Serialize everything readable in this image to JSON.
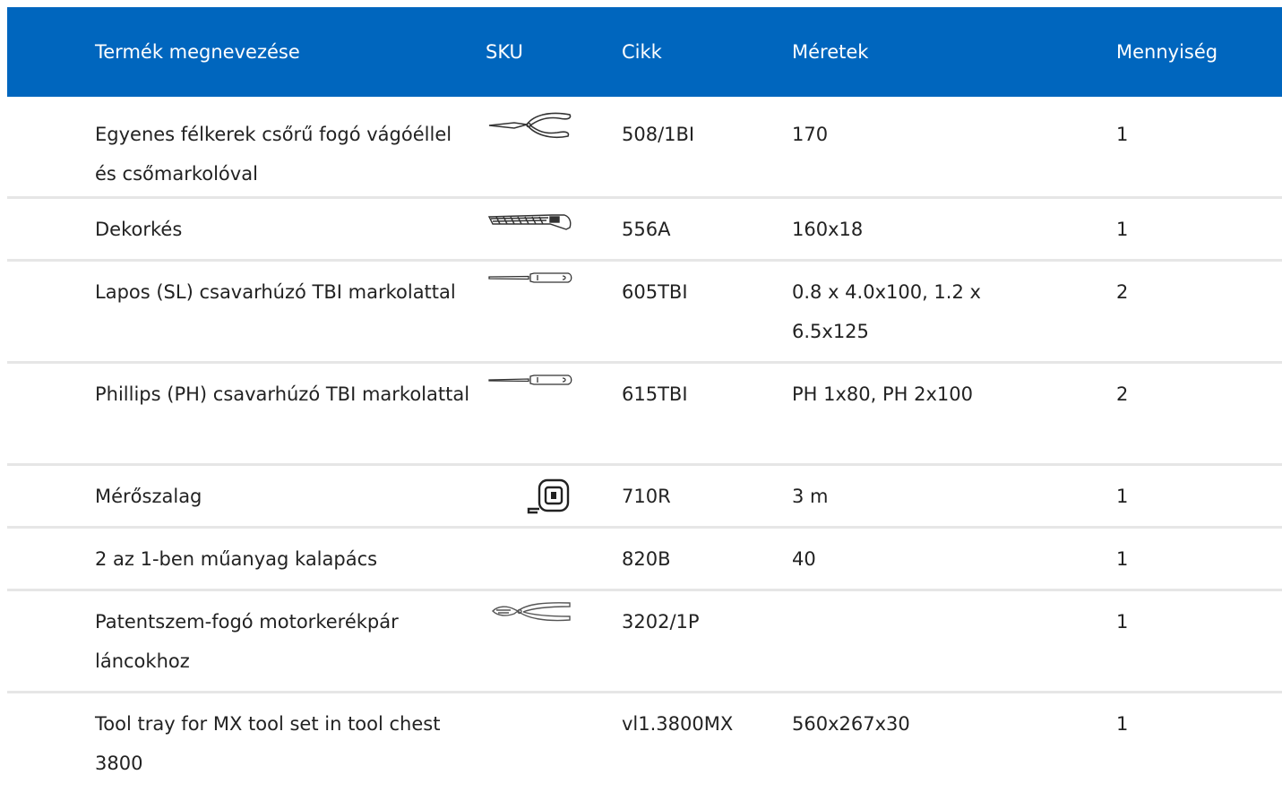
{
  "header": {
    "name": "Termék megnevezése",
    "sku": "SKU",
    "article": "Cikk",
    "size": "Méretek",
    "quantity": "Mennyiség"
  },
  "rows": [
    {
      "name": "Egyenes félkerek csőrű fogó vágóéllel és csőmarkolóval",
      "icon": "pliers-icon",
      "article": "508/1BI",
      "size": "170",
      "quantity": "1"
    },
    {
      "name": "Dekorkés",
      "icon": "utility-knife-icon",
      "article": "556A",
      "size": "160x18",
      "quantity": "1"
    },
    {
      "name": "Lapos (SL) csavarhúzó TBI markolattal",
      "icon": "screwdriver-icon",
      "article": "605TBI",
      "size": "0.8 x 4.0x100, 1.2 x 6.5x125",
      "quantity": "2"
    },
    {
      "name": "Phillips (PH) csavarhúzó TBI markolattal",
      "icon": "screwdriver-icon",
      "article": "615TBI",
      "size": "PH 1x80, PH 2x100",
      "quantity": "2"
    },
    {
      "name": "Mérőszalag",
      "icon": "tape-measure-icon",
      "article": "710R",
      "size": "3 m",
      "quantity": "1"
    },
    {
      "name": "2 az 1-ben műanyag kalapács",
      "icon": "",
      "article": "820B",
      "size": "40",
      "quantity": "1"
    },
    {
      "name": "Patentszem-fogó motorkerékpár láncokhoz",
      "icon": "chain-pliers-icon",
      "article": "3202/1P",
      "size": "",
      "quantity": "1"
    },
    {
      "name": "Tool tray for MX tool set in tool chest 3800",
      "icon": "",
      "article": "vl1.3800MX",
      "size": "560x267x30",
      "quantity": "1"
    }
  ]
}
